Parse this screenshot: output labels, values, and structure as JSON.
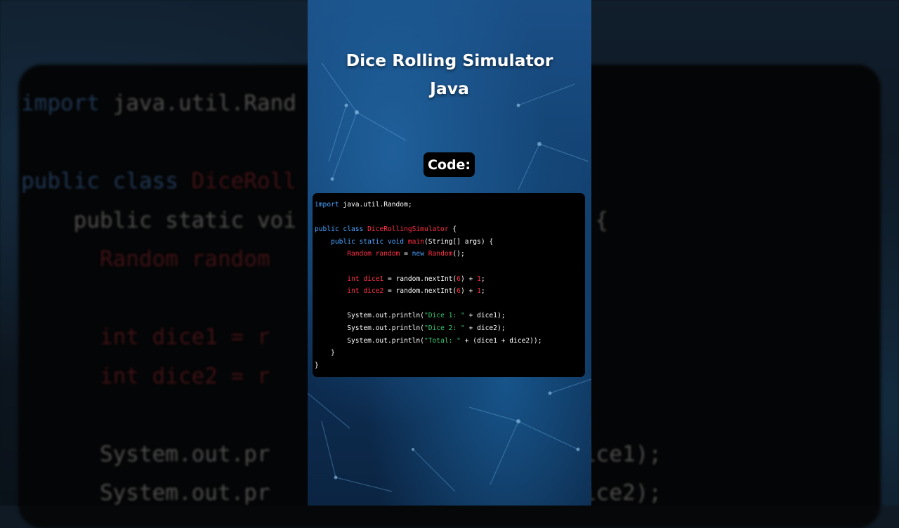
{
  "video": {
    "title_line1": "Dice Rolling Simulator",
    "title_line2": "Java",
    "code_label": "Code:"
  },
  "code": {
    "l1_kw": "import",
    "l1_rest": " java.util.Random;",
    "l3_kw": "public class",
    "l3_cls": "DiceRollingSimulator",
    "l3_rest": " {",
    "l4_kw": "public static void",
    "l4_method": "main",
    "l4_rest": "(String[] args) {",
    "l5_type": "Random random",
    "l5_eq": " = ",
    "l5_new": "new",
    "l5_cls": "Random",
    "l5_end": "();",
    "l7_type": "int dice1",
    "l7_mid": " = random.nextInt(",
    "l7_num": "6",
    "l7_plus": ") + ",
    "l7_one": "1",
    "l7_end": ";",
    "l8_type": "int dice2",
    "l8_mid": " = random.nextInt(",
    "l8_num": "6",
    "l8_plus": ") + ",
    "l8_one": "1",
    "l8_end": ";",
    "l10_start": "System.out.println(",
    "l10_str": "\"Dice 1: \"",
    "l10_end": " + dice1);",
    "l11_start": "System.out.println(",
    "l11_str": "\"Dice 2: \"",
    "l11_end": " + dice2);",
    "l12_start": "System.out.println(",
    "l12_str": "\"Total: \"",
    "l12_end": " + (dice1 + dice2));",
    "l13": "}",
    "l14": "}"
  },
  "background_code": {
    "b1_kw": "import",
    "b1_rest": " java.util.Rand",
    "b2_kw": "public class",
    "b2_cls": "DiceRoll",
    "b3": "    public static voi",
    "b3_tail": ") {",
    "b4_cls": "Random random",
    "b6": "int dice1 = r",
    "b7": "int dice2 = r",
    "b9": "System.out.pr",
    "b9_tail": "ice1);",
    "b10": "System.out.pr",
    "b10_tail": "ice2);"
  },
  "colors": {
    "keyword": "#4aa3ff",
    "class_name": "#ff2e43",
    "string": "#35c96e",
    "number": "#ff2e43",
    "code_background": "#000000",
    "frame_background": "#134272"
  }
}
